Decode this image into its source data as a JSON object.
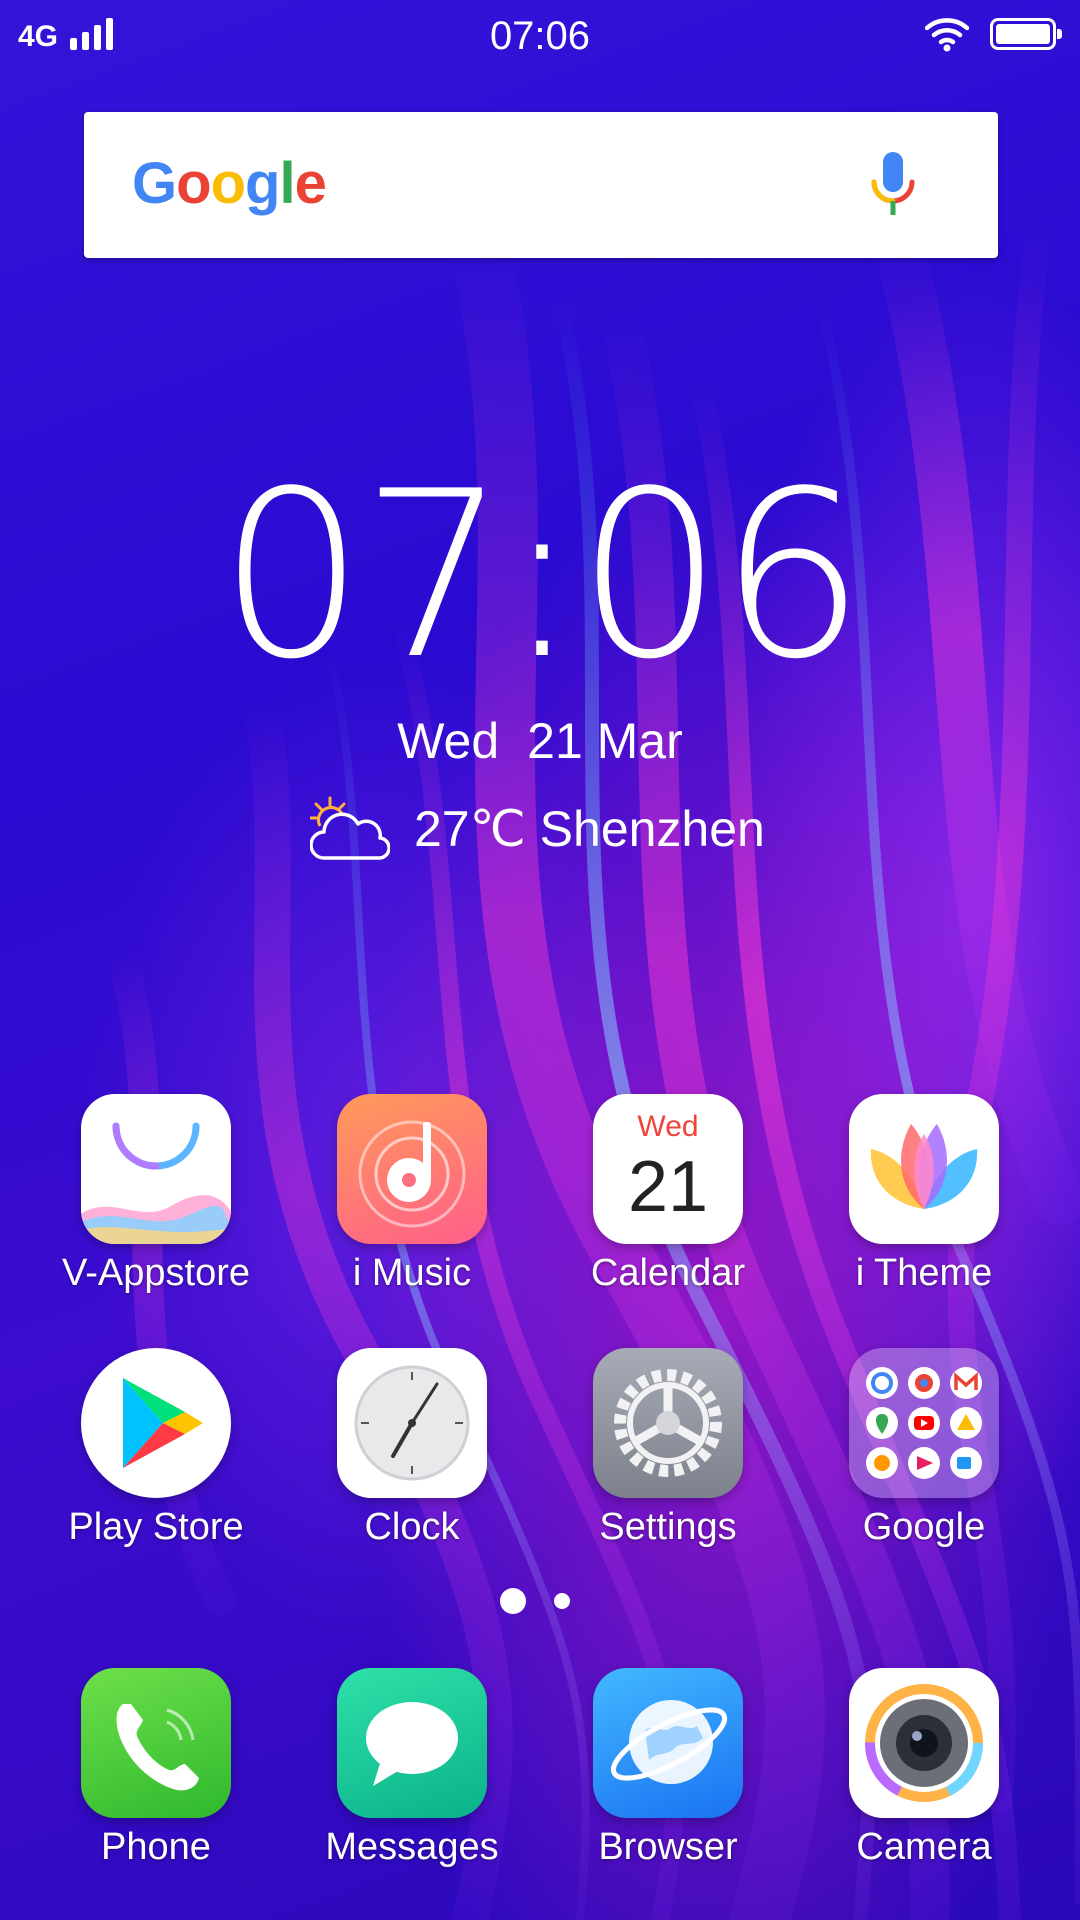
{
  "status_bar": {
    "network": "4G",
    "time": "07:06",
    "icons": [
      "signal-icon",
      "wifi-icon",
      "battery-icon"
    ]
  },
  "search_widget": {
    "logo_letters": [
      {
        "char": "G",
        "color": "#4285F4"
      },
      {
        "char": "o",
        "color": "#EA4335"
      },
      {
        "char": "o",
        "color": "#FBBC05"
      },
      {
        "char": "g",
        "color": "#4285F4"
      },
      {
        "char": "l",
        "color": "#34A853"
      },
      {
        "char": "e",
        "color": "#EA4335"
      }
    ],
    "mic_icon": "microphone-icon"
  },
  "clock_widget": {
    "time": "07:06",
    "weekday": "Wed",
    "date": "21 Mar",
    "weather_icon": "partly-cloudy-icon",
    "weather_text": "27℃ Shenzhen"
  },
  "apps": {
    "row1": [
      {
        "label": "V-Appstore",
        "icon": "v-appstore-icon"
      },
      {
        "label": "i Music",
        "icon": "music-icon"
      },
      {
        "label": "Calendar",
        "icon": "calendar-icon",
        "icon_weekday": "Wed",
        "icon_day": "21"
      },
      {
        "label": "i Theme",
        "icon": "lotus-theme-icon"
      }
    ],
    "row2": [
      {
        "label": "Play Store",
        "icon": "play-store-icon"
      },
      {
        "label": "Clock",
        "icon": "clock-icon"
      },
      {
        "label": "Settings",
        "icon": "settings-gear-icon"
      },
      {
        "label": "Google",
        "icon": "google-folder-icon"
      }
    ],
    "dock": [
      {
        "label": "Phone",
        "icon": "phone-icon"
      },
      {
        "label": "Messages",
        "icon": "messages-icon"
      },
      {
        "label": "Browser",
        "icon": "browser-globe-icon"
      },
      {
        "label": "Camera",
        "icon": "camera-icon"
      }
    ]
  },
  "page_indicator": {
    "pages": 2,
    "current": 1
  }
}
